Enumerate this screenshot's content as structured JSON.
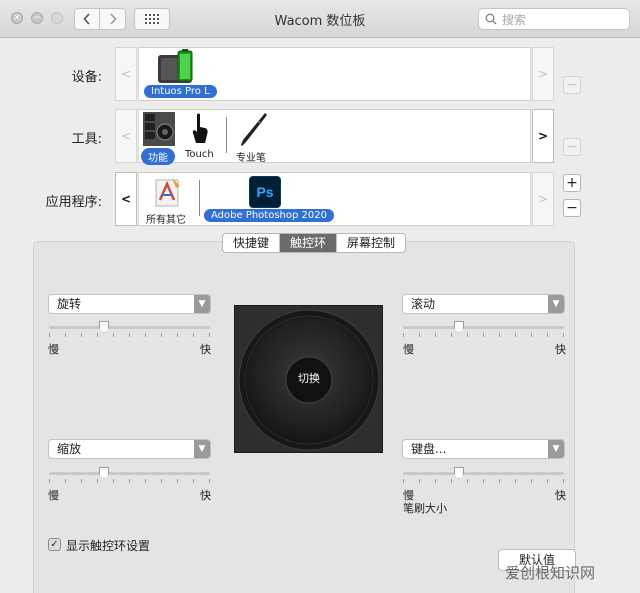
{
  "window": {
    "title": "Wacom 数位板",
    "search_placeholder": "搜索"
  },
  "rows": {
    "device": {
      "label": "设备:",
      "items": [
        {
          "caption": "Intuos Pro L"
        }
      ]
    },
    "tool": {
      "label": "工具:",
      "items": [
        {
          "caption": "功能"
        },
        {
          "caption": "Touch"
        },
        {
          "caption": "专业笔"
        }
      ]
    },
    "app": {
      "label": "应用程序:",
      "items": [
        {
          "caption": "所有其它"
        },
        {
          "caption": "Adobe Photoshop 2020",
          "icon_text": "Ps"
        }
      ]
    }
  },
  "buttons": {
    "minus": "−",
    "plus": "+",
    "left": "<",
    "right": ">"
  },
  "tabs": [
    {
      "label": "快捷键"
    },
    {
      "label": "触控环"
    },
    {
      "label": "屏幕控制"
    }
  ],
  "active_tab": 1,
  "left": {
    "top": {
      "selected": "旋转",
      "slow": "慢",
      "fast": "快",
      "value": 0.35
    },
    "bottom": {
      "selected": "缩放",
      "slow": "慢",
      "fast": "快",
      "value": 0.35
    }
  },
  "right": {
    "top": {
      "selected": "滚动",
      "slow": "慢",
      "fast": "快",
      "value": 0.35
    },
    "bottom": {
      "selected": "键盘...",
      "slow": "慢",
      "fast": "快",
      "value": 0.35,
      "sub_label": "笔刷大小"
    }
  },
  "wheel": {
    "center_label": "切换"
  },
  "checkbox": {
    "label": "显示触控环设置",
    "checked": true,
    "mark": "✓"
  },
  "default_button": "默认值",
  "watermark": "爱创根知识网",
  "colors": {
    "accent": "#2f6fd6",
    "photoshop_bg": "#001e36",
    "photoshop_fg": "#31a8ff"
  }
}
